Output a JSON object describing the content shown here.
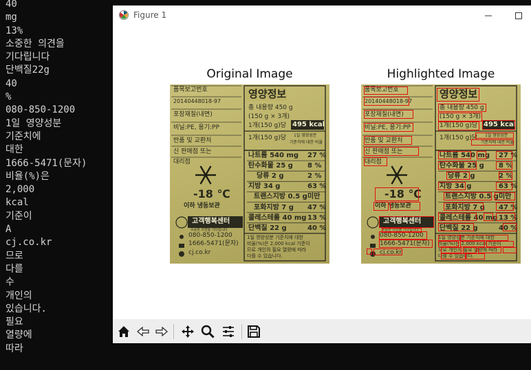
{
  "terminal": {
    "lines": [
      "40",
      "mg",
      "13%",
      "소중한 의견을",
      "기다립니다",
      "단백질22g",
      "40",
      "%",
      "080-850-1200",
      "1일 영양성분",
      "기준치에",
      "대한",
      "1666-5471(문자)",
      "비율(%)은",
      "2,000",
      "kcal",
      "기준이",
      "A",
      "cj.co.kr",
      "므로",
      "다를",
      "수",
      "개인의",
      "있습니다.",
      "필요",
      "열량에",
      "따라"
    ]
  },
  "window": {
    "title": "Figure 1",
    "icon": "matplotlib-icon"
  },
  "figure": {
    "left_title": "Original Image",
    "right_title": "Highlighted Image"
  },
  "label": {
    "report_title": "품목보고번호",
    "report_number": "20140448018-97",
    "packaging_title": "포장재질(내면)",
    "packaging_material": "비닐:PE, 용기:PP",
    "exchange": "반품 및 교환처",
    "exchange_place": "신 판매점 또는",
    "store": "대리점",
    "nutrition_title": "영양정보",
    "total_content": "총 내용량 450 g",
    "serving": "(150 g × 3개)",
    "per_serving": "1개(150 g)당",
    "kcal": "495 kcal",
    "per_serving_header": "1개(150 g)당",
    "daily_header": "1일 영양성분",
    "daily_header2": "기준치에 대한 비율",
    "rows": [
      {
        "name": "나트륨 540 mg",
        "pct": "27 %"
      },
      {
        "name": "탄수화물 25 g",
        "pct": "8 %"
      },
      {
        "name": "당류 2 g",
        "pct": "2 %"
      },
      {
        "name": "지방 34 g",
        "pct": "63 %"
      },
      {
        "name": "트랜스지방 0.5 g",
        "pct": "미만"
      },
      {
        "name": "포화지방 7 g",
        "pct": "47 %"
      },
      {
        "name": "콜레스테롤 40 mg",
        "pct": "13 %"
      },
      {
        "name": "단백질 22 g",
        "pct": "40 %"
      }
    ],
    "footnote1": "1일 영양성분 기준치에 대한",
    "footnote2": "비율(%)은 2,000 kcal 기준이",
    "footnote3": "므로 개인의 필요 열량에 따라",
    "footnote4": "다를 수 있습니다.",
    "temp": "-18 ℃",
    "storage": "이하 냉동보관",
    "service_title": "고객행복센터",
    "service_sub": "소중한 의견을 기다립니다",
    "phone": "080-850-1200",
    "sms": "1666-5471(문자)",
    "web": "cj.co.kr"
  },
  "toolbar": {
    "items": [
      "home-icon",
      "back-icon",
      "forward-icon",
      "pan-icon",
      "zoom-icon",
      "configure-subplots-icon",
      "save-icon"
    ]
  }
}
